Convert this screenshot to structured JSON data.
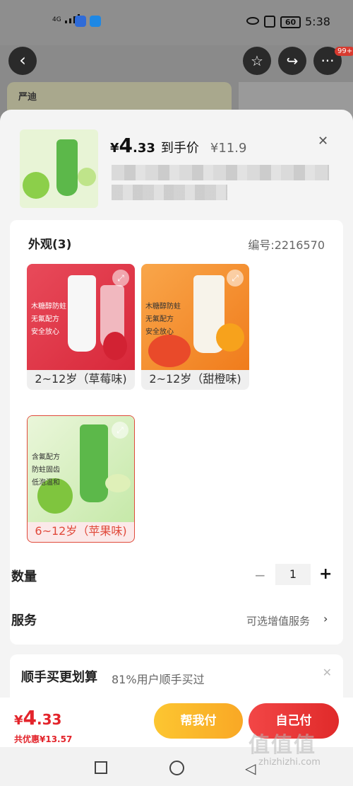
{
  "status_bar": {
    "network": "4G",
    "battery": "60",
    "time": "5:38"
  },
  "top_nav": {
    "back_icon": "chevron-left-icon",
    "favorite_icon": "star-icon",
    "share_icon": "share-icon",
    "more_icon": "more-dots-icon",
    "more_badge": "99+"
  },
  "background": {
    "brand_logo_text": "严迪",
    "brand_logo_small": "YANDY严迪"
  },
  "product": {
    "price_yen": "¥",
    "price_int": "4",
    "price_dec": ".33",
    "price_label": "到手价",
    "original_price": "¥11.9"
  },
  "appearance": {
    "title": "外观(3)",
    "sku_number": "编号:2216570",
    "options": [
      {
        "label": "2~12岁（草莓味)",
        "selected": false,
        "bullets": [
          "木糖醇防蛀",
          "无氟配方",
          "安全放心"
        ]
      },
      {
        "label": "2~12岁（甜橙味)",
        "selected": false,
        "bullets": [
          "木糖醇防蛀",
          "无氟配方",
          "安全放心"
        ]
      },
      {
        "label": "6~12岁（苹果味)",
        "selected": true,
        "bullets": [
          "含氟配方",
          "防蛀固齿",
          "低泡温和"
        ]
      }
    ]
  },
  "quantity": {
    "label": "数量",
    "minus": "−",
    "value": "1",
    "plus": "+"
  },
  "service": {
    "label": "服务",
    "value": "可选增值服务",
    "chevron": "›"
  },
  "bundle": {
    "title": "顺手买更划算",
    "subtitle": "81%用户顺手买过"
  },
  "checkout": {
    "total_yen": "¥",
    "total_int": "4",
    "total_dec": ".33",
    "saving": "共优惠¥13.57",
    "help_pay": "帮我付",
    "self_pay": "自己付"
  },
  "watermark": {
    "text": "值值值",
    "url": "zhizhizhi.com"
  },
  "colors": {
    "accent_red": "#e3242b",
    "help_yellow": "#f9a825"
  }
}
